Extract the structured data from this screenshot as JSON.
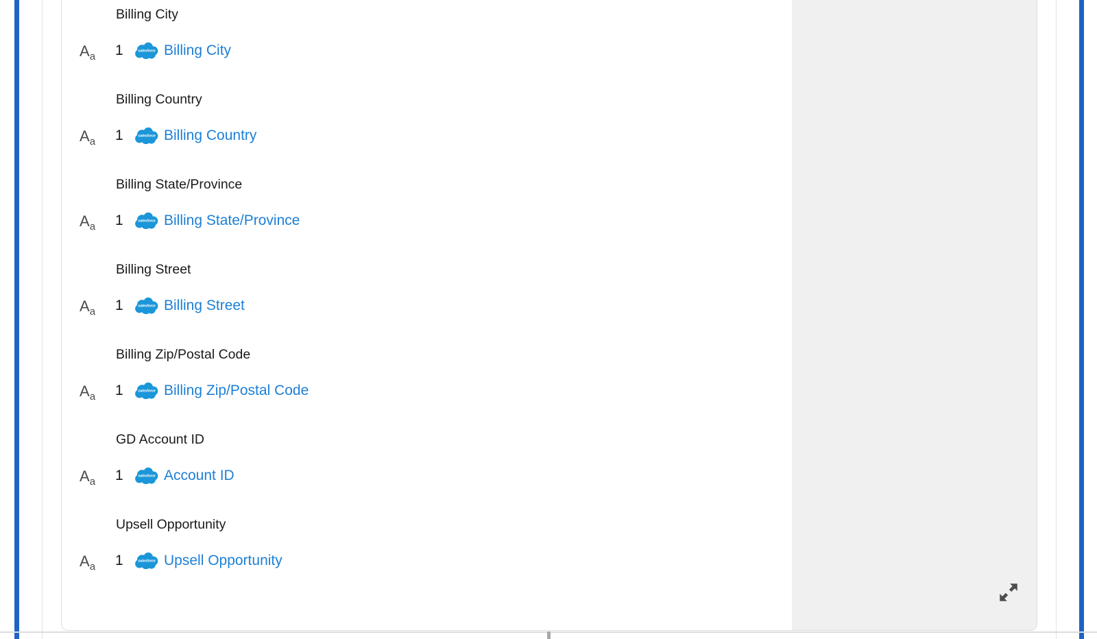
{
  "window": {
    "accent_color": "#1f63c4",
    "card_background": "#ffffff",
    "detail_pane_color": "#f0f0f0",
    "link_color": "#1d7fd6",
    "heading_color": "#1a1a1a"
  },
  "field_mappings": [
    {
      "heading": "Billing City",
      "type_icon": "text-type-icon",
      "count": "1",
      "source_icon": "salesforce-cloud-icon",
      "source_field": "Billing City"
    },
    {
      "heading": "Billing Country",
      "type_icon": "text-type-icon",
      "count": "1",
      "source_icon": "salesforce-cloud-icon",
      "source_field": "Billing Country"
    },
    {
      "heading": "Billing State/Province",
      "type_icon": "text-type-icon",
      "count": "1",
      "source_icon": "salesforce-cloud-icon",
      "source_field": "Billing State/Province"
    },
    {
      "heading": "Billing Street",
      "type_icon": "text-type-icon",
      "count": "1",
      "source_icon": "salesforce-cloud-icon",
      "source_field": "Billing Street"
    },
    {
      "heading": "Billing Zip/Postal Code",
      "type_icon": "text-type-icon",
      "count": "1",
      "source_icon": "salesforce-cloud-icon",
      "source_field": "Billing Zip/Postal Code"
    },
    {
      "heading": "GD Account ID",
      "type_icon": "text-type-icon",
      "count": "1",
      "source_icon": "salesforce-cloud-icon",
      "source_field": "Account ID"
    },
    {
      "heading": "Upsell Opportunity",
      "type_icon": "text-type-icon",
      "count": "1",
      "source_icon": "salesforce-cloud-icon",
      "source_field": "Upsell Opportunity"
    }
  ],
  "type_glyph": {
    "big": "A",
    "small": "a"
  },
  "salesforce_logo": {
    "wordmark": "salesforce"
  },
  "detail_pane": {
    "expand_icon": "expand-diagonal-icon"
  }
}
